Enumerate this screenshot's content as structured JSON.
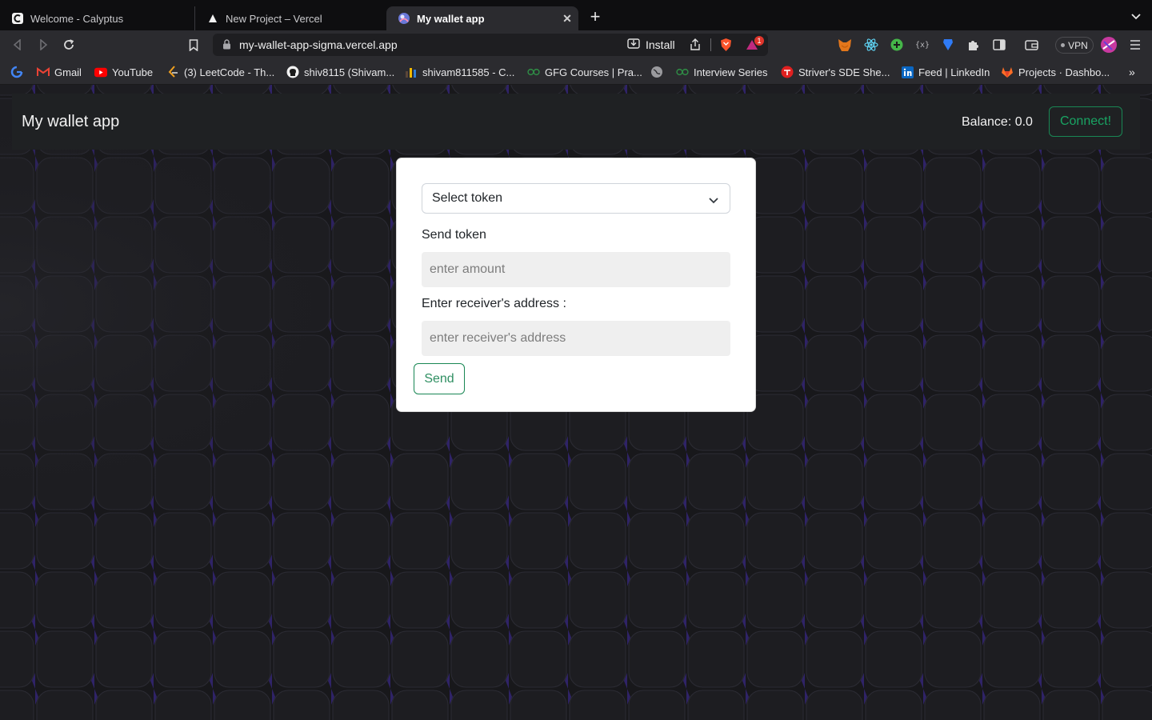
{
  "browser": {
    "tabs": [
      {
        "title": "Welcome - Calyptus",
        "favicon": "calyptus-icon"
      },
      {
        "title": "New Project – Vercel",
        "favicon": "vercel-triangle-icon"
      },
      {
        "title": "My wallet app",
        "favicon": "wallet-app-icon",
        "active": true
      }
    ],
    "url": "my-wallet-app-sigma.vercel.app",
    "install_label": "Install",
    "vpn_label": "VPN",
    "brave_rewards_badge": "1",
    "bookmarks": [
      {
        "label": "",
        "icon": "google-icon"
      },
      {
        "label": "Gmail",
        "icon": "gmail-icon"
      },
      {
        "label": "YouTube",
        "icon": "youtube-icon"
      },
      {
        "label": "(3) LeetCode - Th...",
        "icon": "leetcode-icon"
      },
      {
        "label": "shiv8115 (Shivam...",
        "icon": "github-icon"
      },
      {
        "label": "shivam811585 - C...",
        "icon": "codechef-icon"
      },
      {
        "label": "GFG Courses | Pra...",
        "icon": "gfg-icon"
      },
      {
        "label": "",
        "icon": "globe-icon"
      },
      {
        "label": "Interview Series",
        "icon": "gfg-icon"
      },
      {
        "label": "Striver's SDE She...",
        "icon": "tuf-icon"
      },
      {
        "label": "Feed | LinkedIn",
        "icon": "linkedin-icon"
      },
      {
        "label": "Projects · Dashbo...",
        "icon": "gitlab-icon"
      }
    ]
  },
  "app": {
    "title": "My wallet app",
    "balance": "Balance: 0.0",
    "connect_label": "Connect!",
    "form": {
      "token_select": "Select token",
      "send_token_label": "Send token",
      "amount_placeholder": "enter amount",
      "address_label": "Enter receiver's address :",
      "address_placeholder": "enter receiver's address",
      "send_label": "Send"
    }
  },
  "colors": {
    "success_green": "#198754",
    "page_bg": "#19191c",
    "grid_accent": "#6b3fd6"
  }
}
